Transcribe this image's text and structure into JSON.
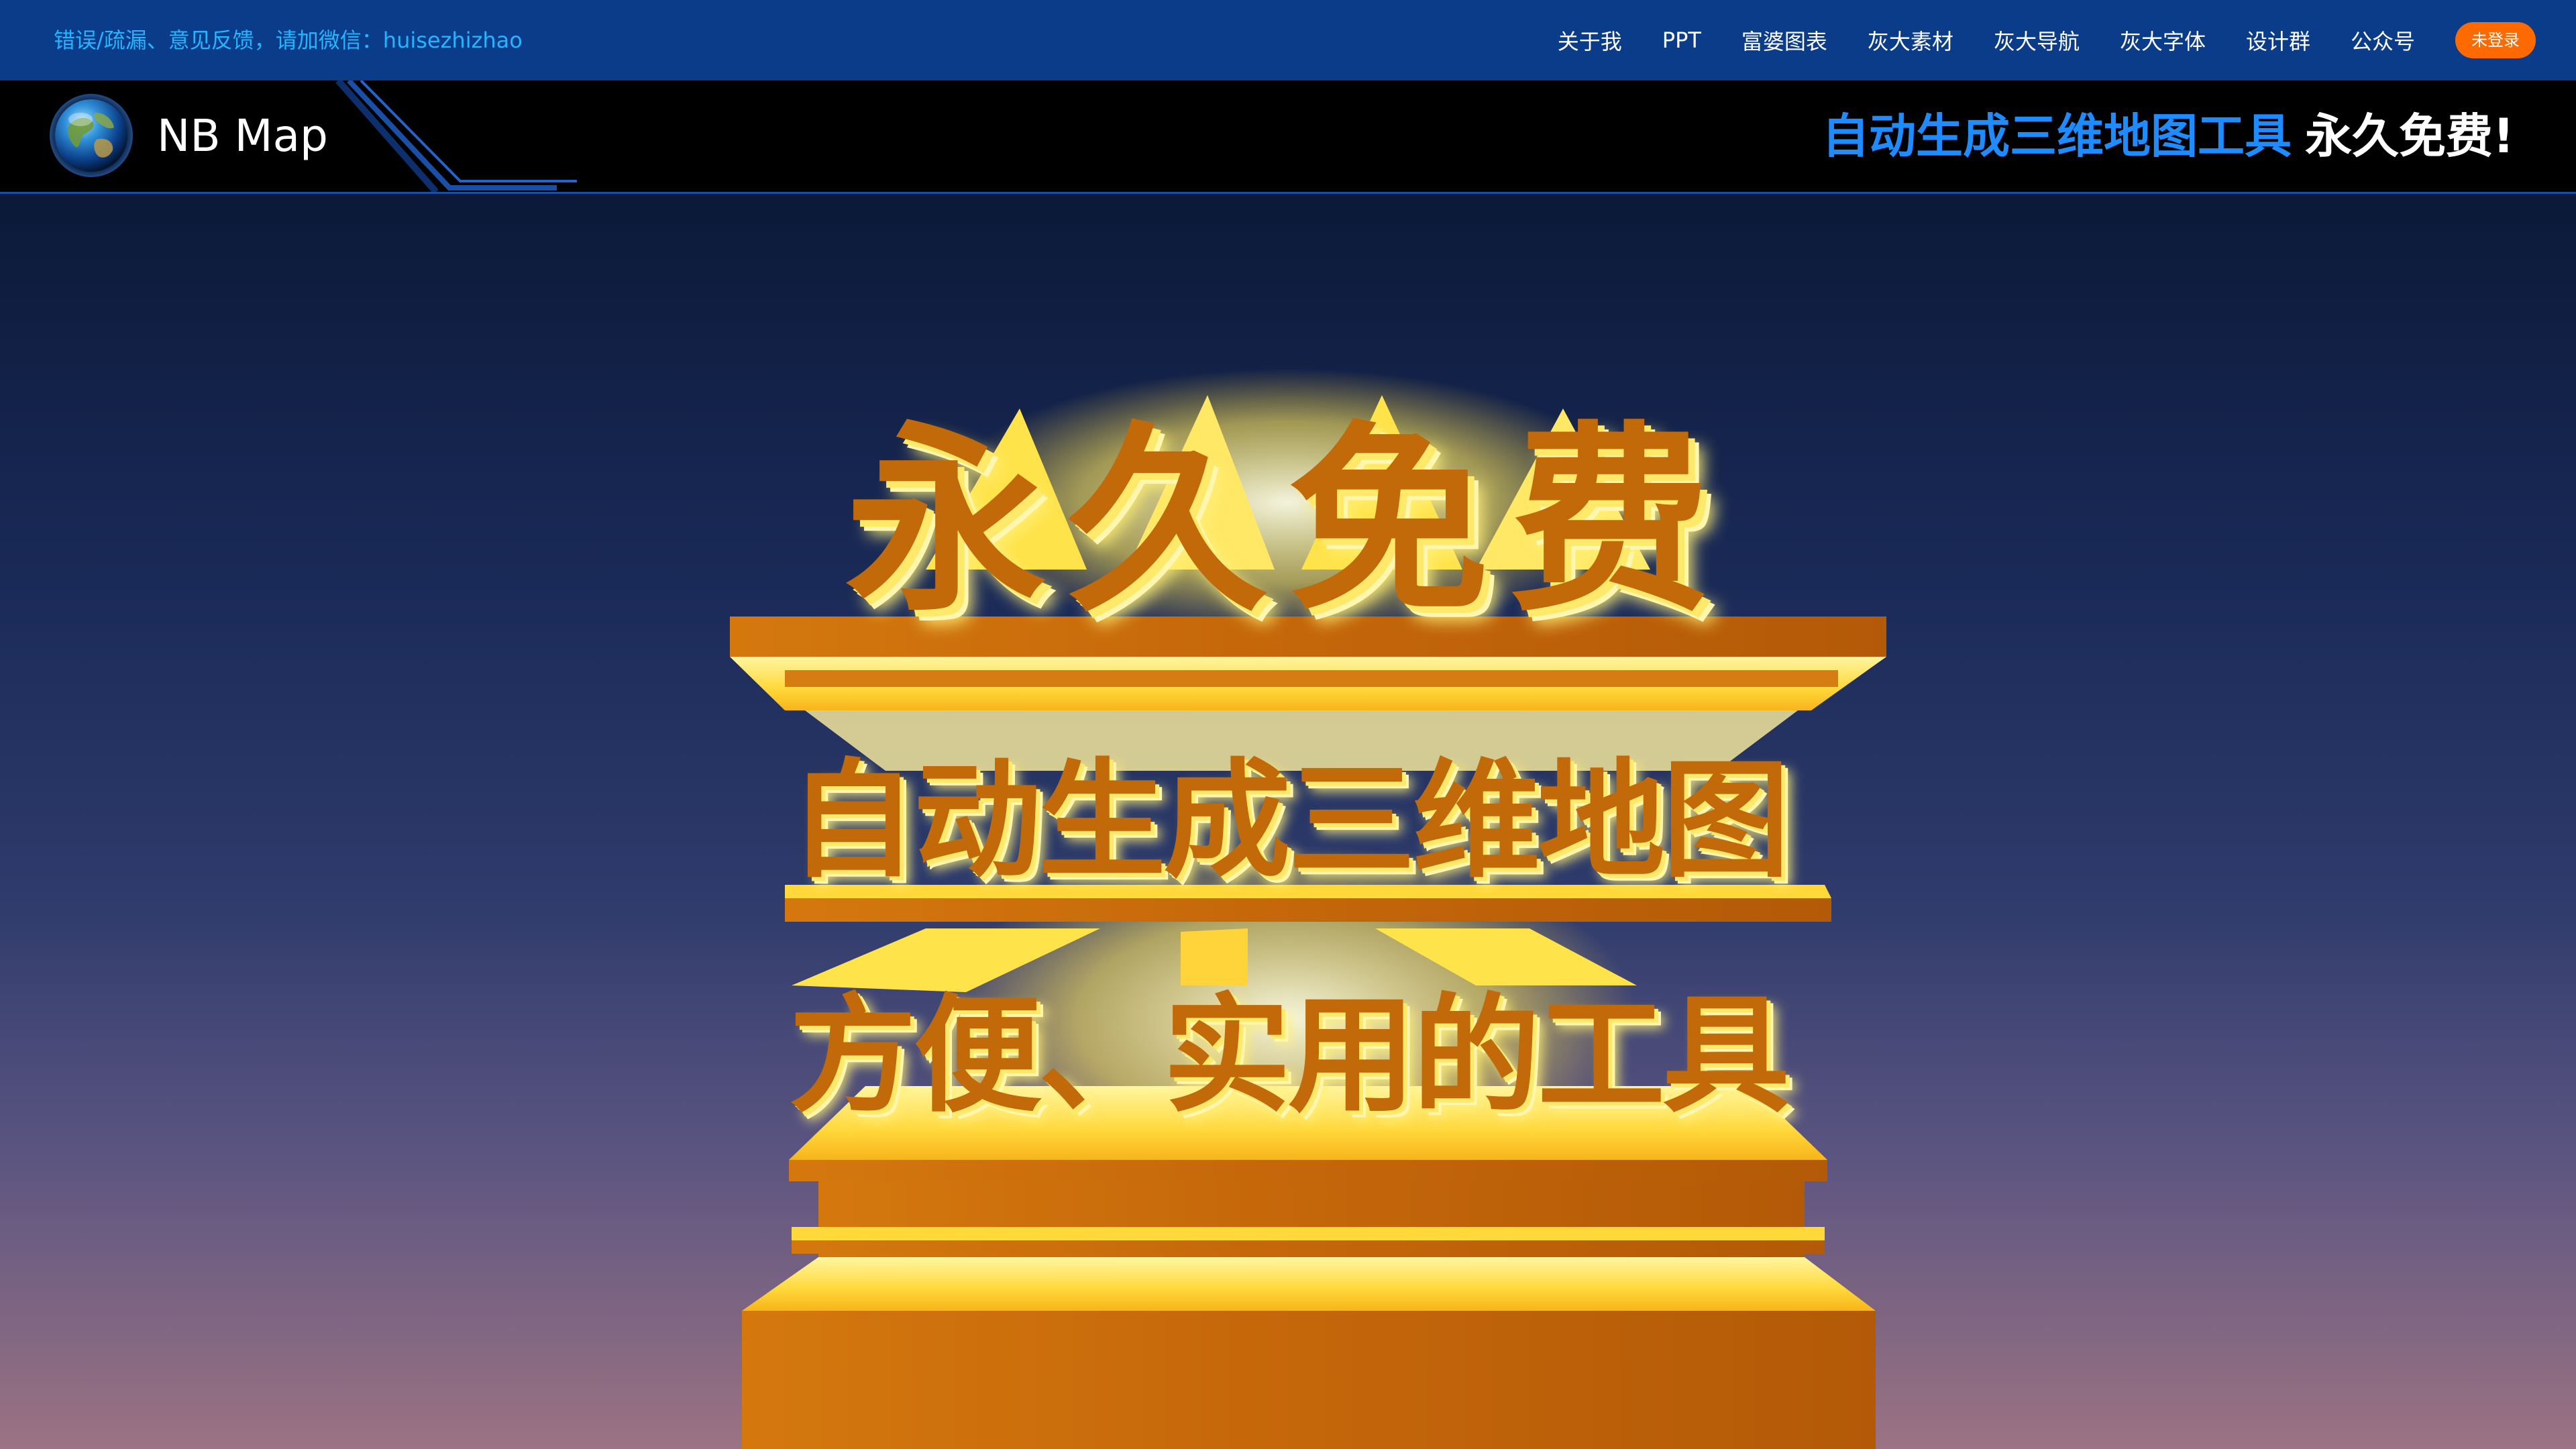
{
  "topbar": {
    "feedback_label": "错误/疏漏、意见反馈，请加微信：",
    "wechat_id": "huisezhizhao",
    "nav": [
      "关于我",
      "PPT",
      "富婆图表",
      "灰大素材",
      "灰大导航",
      "灰大字体",
      "设计群",
      "公众号"
    ],
    "login_label": "未登录"
  },
  "header": {
    "brand_name": "NB Map",
    "slogan_highlight": "自动生成三维地图工具",
    "slogan_rest": "永久免费!"
  },
  "hero": {
    "line_1": "永久免费",
    "line_2": "自动生成三维地图",
    "line_3": "方便、实用的工具"
  },
  "colors": {
    "topbar_bg": "#0b3c8a",
    "feedback_text": "#25b5ff",
    "login_button": "#ff6a00",
    "slogan_blue": "#1e8cff",
    "hero_orange": "#c2690a",
    "hero_yellow": "#ffe96a"
  },
  "icons": {
    "logo": "globe-icon"
  }
}
